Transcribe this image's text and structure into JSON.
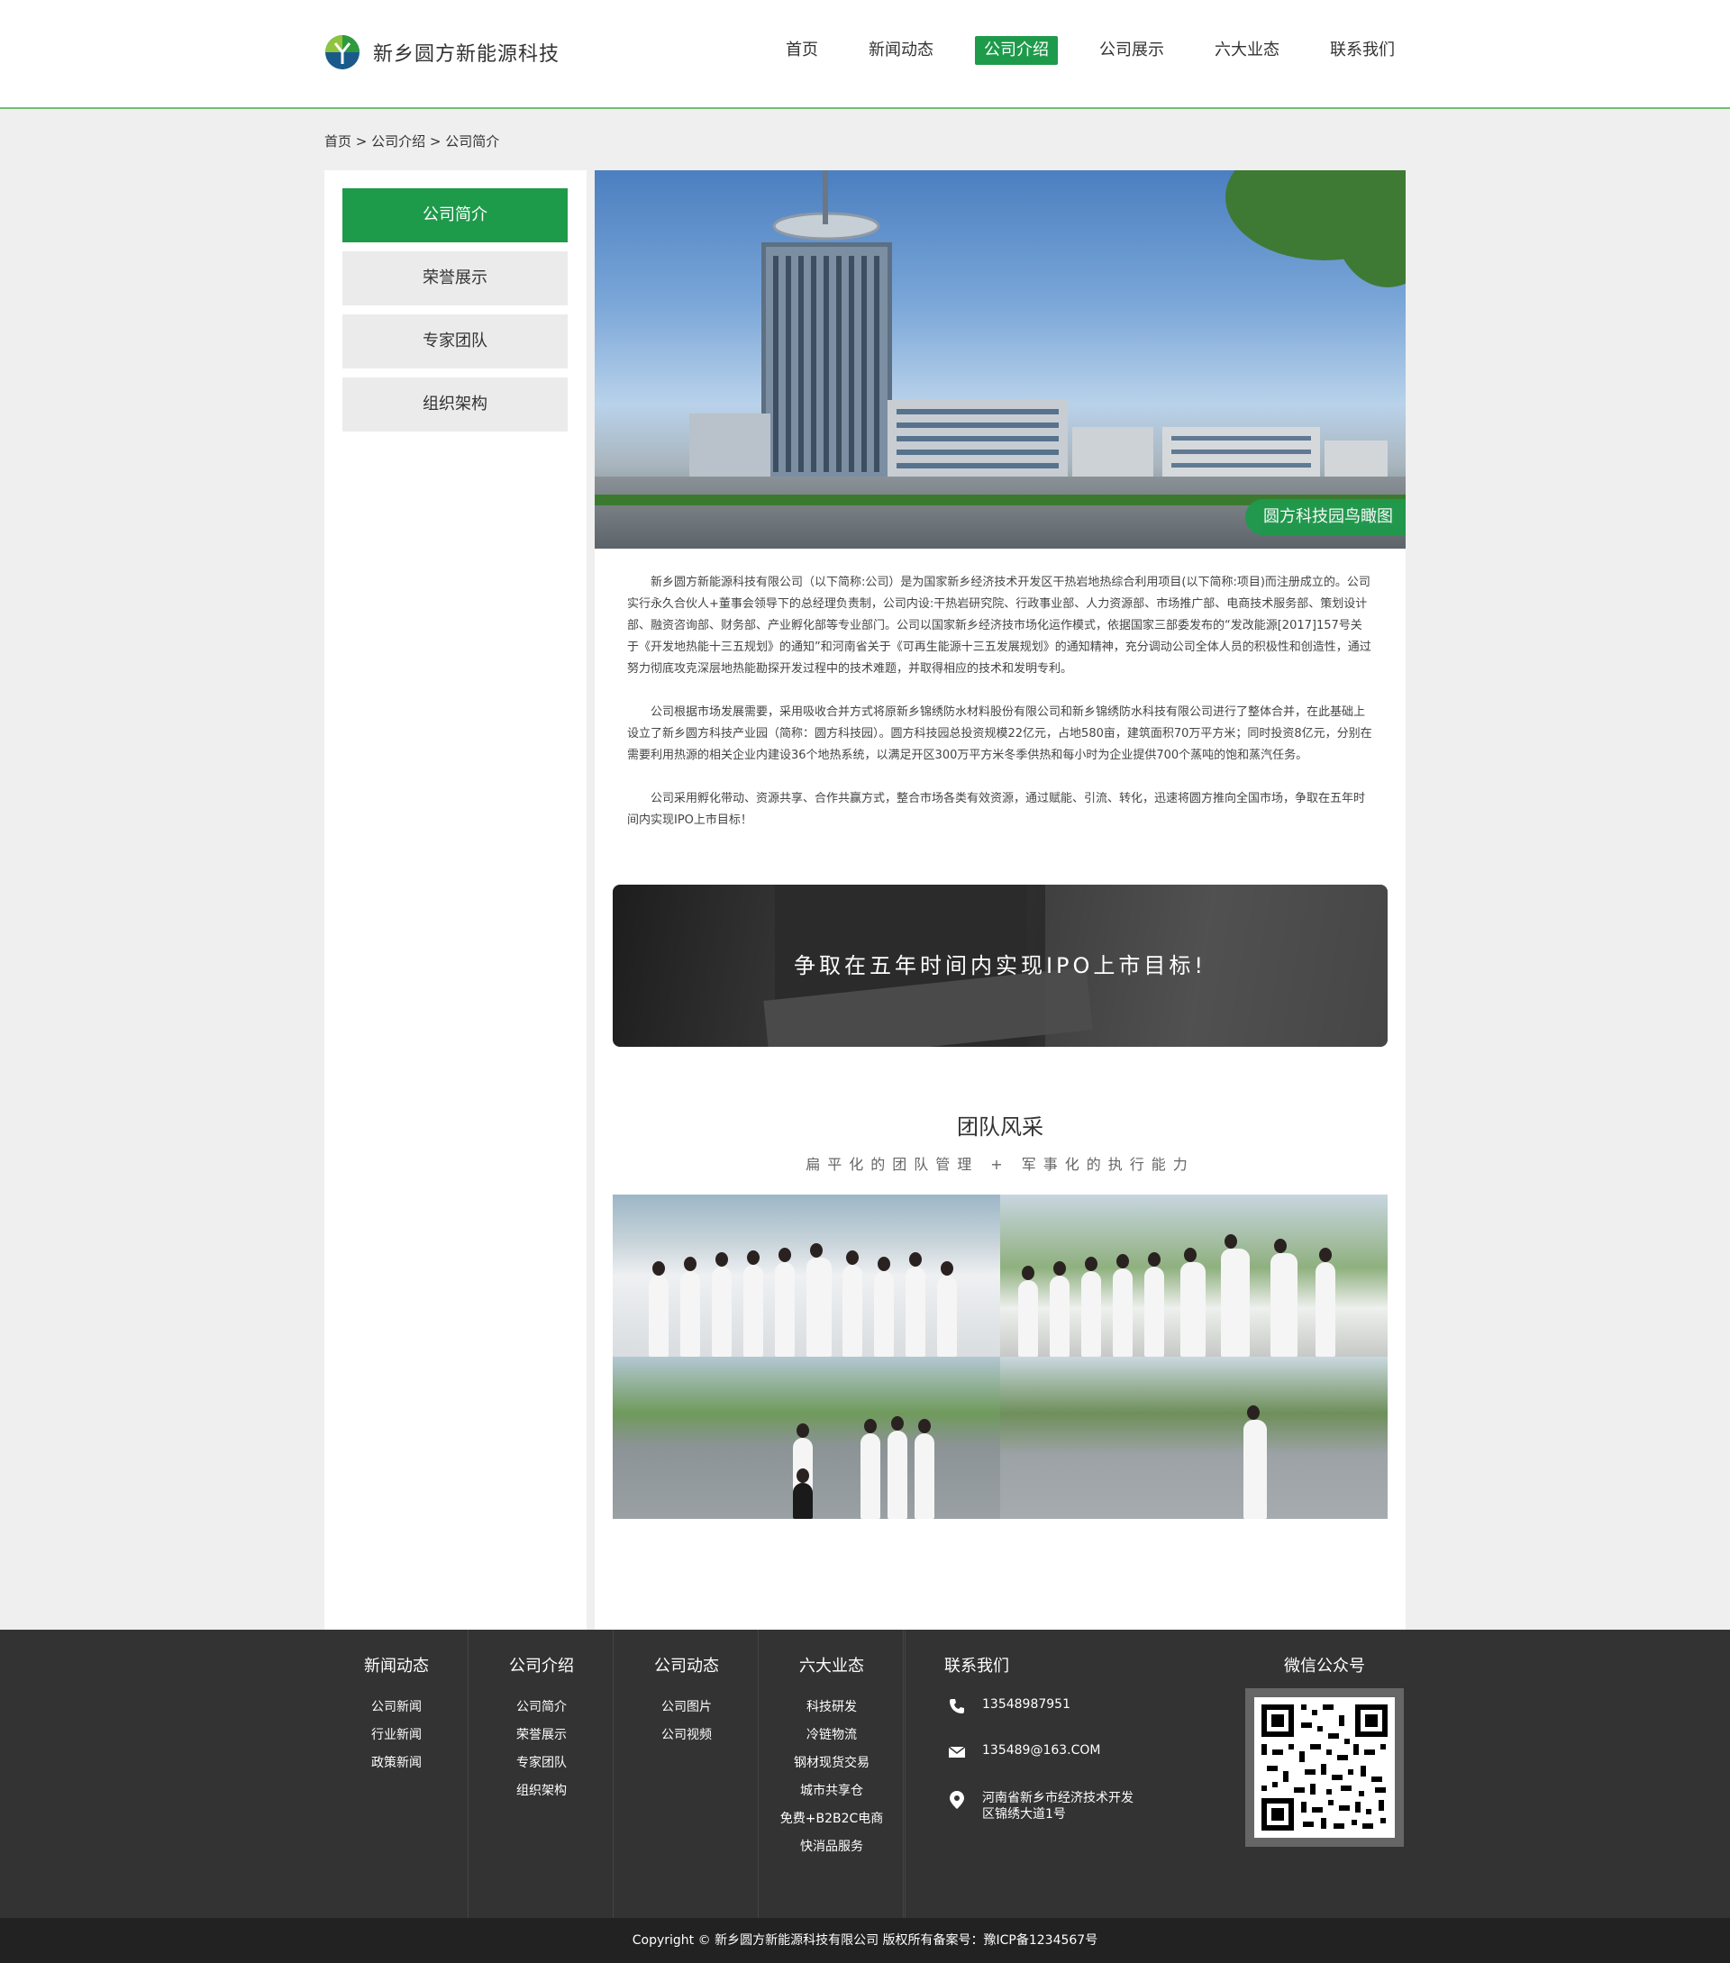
{
  "header": {
    "logo_text": "新乡圆方新能源科技",
    "nav": [
      "首页",
      "新闻动态",
      "公司介绍",
      "公司展示",
      "六大业态",
      "联系我们"
    ],
    "active_nav": "公司介绍"
  },
  "breadcrumb": "首页 > 公司介绍 > 公司简介",
  "sidebar": {
    "items": [
      "公司简介",
      "荣誉展示",
      "专家团队",
      "组织架构"
    ]
  },
  "hero": {
    "caption": "圆方科技园鸟瞰图"
  },
  "intro": {
    "paragraphs": [
      "新乡圆方新能源科技有限公司（以下简称:公司）是为国家新乡经济技术开发区干热岩地热综合利用项目(以下简称:项目)而注册成立的。公司实行永久合伙人+董事会领导下的总经理负责制，公司内设:干热岩研究院、行政事业部、人力资源部、市场推广部、电商技术服务部、策划设计部、融资咨询部、财务部、产业孵化部等专业部门。公司以国家新乡经济技市场化运作模式，依据国家三部委发布的“发改能源[2017]157号关于《开发地热能十三五规划》的通知”和河南省关于《可再生能源十三五发展规划》的通知精神，充分调动公司全体人员的积极性和创造性，通过努力彻底攻克深层地热能勘探开发过程中的技术难题，并取得相应的技术和发明专利。",
      "公司根据市场发展需要，采用吸收合并方式将原新乡锦绣防水材料股份有限公司和新乡锦绣防水科技有限公司进行了整体合并，在此基础上设立了新乡圆方科技产业园（简称：圆方科技园）。圆方科技园总投资规模22亿元，占地580亩，建筑面积70万平方米；同时投资8亿元，分别在需要利用热源的相关企业内建设36个地热系统，以满足开区300万平方米冬季供热和每小时为企业提供700个蒸吨的饱和蒸汽任务。",
      "公司采用孵化带动、资源共享、合作共赢方式，整合市场各类有效资源，通过赋能、引流、转化，迅速将圆方推向全国市场，争取在五年时间内实现IPO上市目标！"
    ]
  },
  "banner": {
    "text": "争取在五年时间内实现IPO上市目标!"
  },
  "team": {
    "title": "团队风采",
    "subtitle": "扁平化的团队管理   +   军事化的执行能力"
  },
  "footer": {
    "columns": [
      {
        "head": "新闻动态",
        "links": [
          "公司新闻",
          "行业新闻",
          "政策新闻"
        ]
      },
      {
        "head": "公司介绍",
        "links": [
          "公司简介",
          "荣誉展示",
          "专家团队",
          "组织架构"
        ]
      },
      {
        "head": "公司动态",
        "links": [
          "公司图片",
          "公司视频"
        ]
      },
      {
        "head": "六大业态",
        "links": [
          "科技研发",
          "冷链物流",
          "钢材现货交易",
          "城市共享仓",
          "免费+B2B2C电商",
          "快消品服务"
        ]
      }
    ],
    "contact": {
      "head": "联系我们",
      "phone": "13548987951",
      "email": "135489@163.COM",
      "address_line1": "河南省新乡市经济技术开发",
      "address_line2": "区锦绣大道1号"
    },
    "wechat": {
      "head": "微信公众号"
    },
    "copyright": "Copyright ©   新乡圆方新能源科技有限公司 版权所有备案号：豫ICP备1234567号"
  },
  "icons": {
    "phone": "phone-icon",
    "email": "mail-icon",
    "location": "location-pin-icon"
  },
  "colors": {
    "brand_green": "#1e9a4b",
    "footer_bg": "#333333"
  }
}
